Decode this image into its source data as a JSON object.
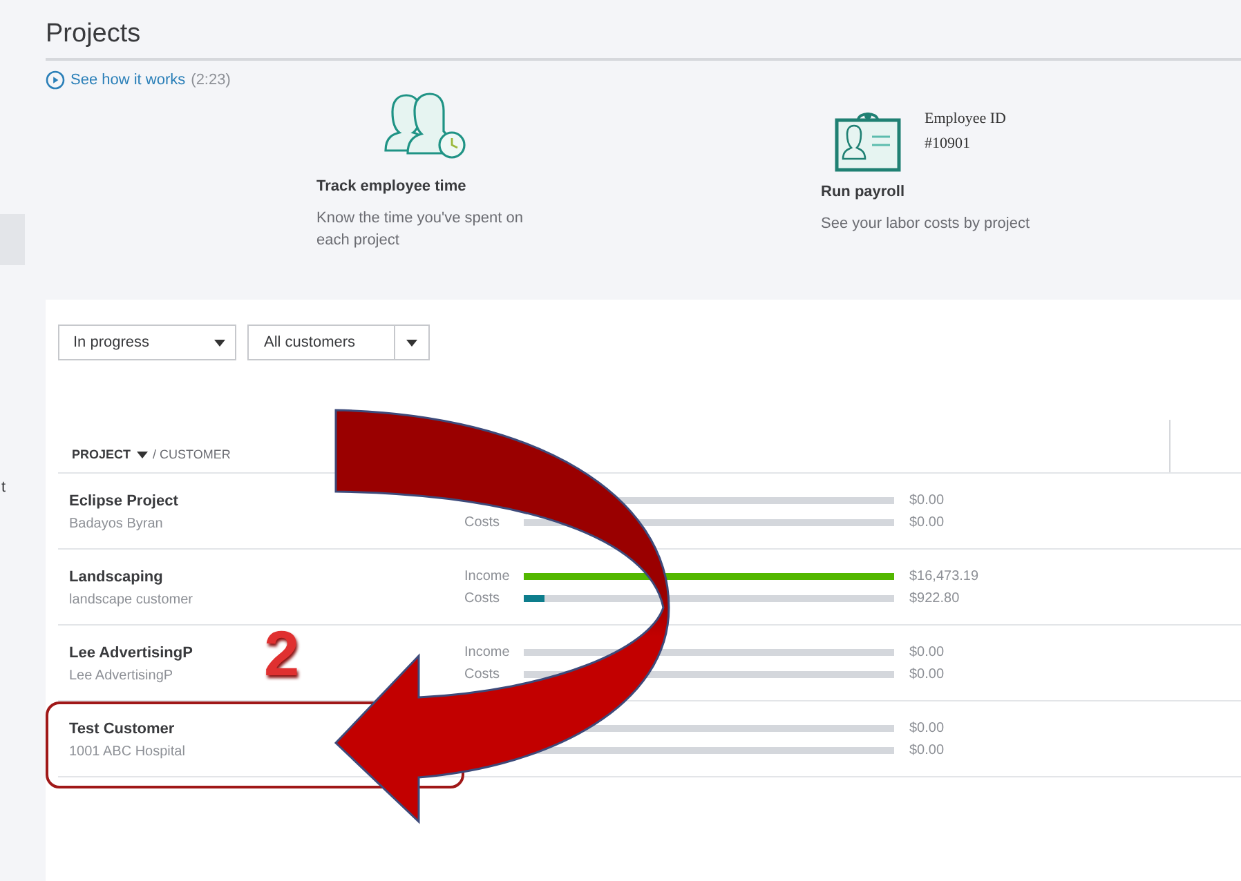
{
  "sidebar": {
    "items": [
      {
        "selected": true
      },
      {
        "label": "t",
        "selected": false
      }
    ]
  },
  "page": {
    "title": "Projects"
  },
  "video_link": {
    "label": "See how it works",
    "duration": "(2:23)"
  },
  "features": [
    {
      "kind": "time",
      "title": "Track employee time",
      "description": "Know the time you've spent on each project"
    },
    {
      "kind": "payroll",
      "title": "Run payroll",
      "description": "See your labor costs by project",
      "badge_lines": [
        "Employee ID",
        "#10901"
      ]
    }
  ],
  "filters": [
    {
      "kind": "plain",
      "value": "In progress"
    },
    {
      "kind": "split",
      "value": "All customers"
    }
  ],
  "table": {
    "columns": [
      {
        "label": "PROJECT",
        "sorted": true
      },
      {
        "label": "/ CUSTOMER",
        "sorted": false
      }
    ],
    "rows": [
      {
        "project": "Eclipse Project",
        "customer": "Badayos Byran",
        "highlighted": false,
        "metrics": [
          {
            "kind": "income",
            "level": 0,
            "amount": "$0.00"
          },
          {
            "kind": "costs",
            "label": "Costs",
            "level": 0,
            "amount": "$0.00"
          }
        ]
      },
      {
        "project": "Landscaping",
        "customer": "landscape customer",
        "highlighted": false,
        "metrics": [
          {
            "kind": "income",
            "label": "Income",
            "level": 1,
            "amount": "$16,473.19"
          },
          {
            "kind": "costs",
            "label": "Costs",
            "level": 0.056,
            "amount": "$922.80"
          }
        ]
      },
      {
        "project": "Lee AdvertisingP",
        "customer": "Lee AdvertisingP",
        "highlighted": false,
        "metrics": [
          {
            "kind": "income",
            "label": "Income",
            "level": 0,
            "amount": "$0.00"
          },
          {
            "kind": "costs",
            "label": "Costs",
            "level": 0,
            "amount": "$0.00"
          }
        ]
      },
      {
        "project": "Test Customer",
        "customer": "1001 ABC Hospital",
        "highlighted": true,
        "metrics": [
          {
            "kind": "income",
            "level": 0,
            "amount": "$0.00"
          },
          {
            "kind": "costs",
            "level": 0,
            "amount": "$0.00"
          }
        ]
      }
    ]
  },
  "annotation": {
    "step": "2"
  }
}
